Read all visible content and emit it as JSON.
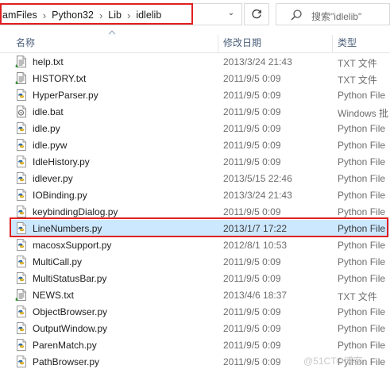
{
  "address": {
    "crumbs": [
      "amFiles",
      "Python32",
      "Lib",
      "idlelib"
    ],
    "separator": "›",
    "dropdown_glyph": "⌄",
    "refresh_glyph": "↻"
  },
  "search": {
    "placeholder": "搜索\"idlelib\""
  },
  "columns": {
    "name": "名称",
    "date": "修改日期",
    "type": "类型"
  },
  "files": [
    {
      "name": "help.txt",
      "date": "2013/3/24 21:43",
      "type": "TXT 文件",
      "icon": "text-file-icon"
    },
    {
      "name": "HISTORY.txt",
      "date": "2011/9/5 0:09",
      "type": "TXT 文件",
      "icon": "text-file-icon"
    },
    {
      "name": "HyperParser.py",
      "date": "2011/9/5 0:09",
      "type": "Python File",
      "icon": "python-file-icon"
    },
    {
      "name": "idle.bat",
      "date": "2011/9/5 0:09",
      "type": "Windows 批",
      "icon": "batch-file-icon"
    },
    {
      "name": "idle.py",
      "date": "2011/9/5 0:09",
      "type": "Python File",
      "icon": "python-file-icon"
    },
    {
      "name": "idle.pyw",
      "date": "2011/9/5 0:09",
      "type": "Python File",
      "icon": "python-file-icon"
    },
    {
      "name": "IdleHistory.py",
      "date": "2011/9/5 0:09",
      "type": "Python File",
      "icon": "python-file-icon"
    },
    {
      "name": "idlever.py",
      "date": "2013/5/15 22:46",
      "type": "Python File",
      "icon": "python-file-icon"
    },
    {
      "name": "IOBinding.py",
      "date": "2013/3/24 21:43",
      "type": "Python File",
      "icon": "python-file-icon"
    },
    {
      "name": "keybindingDialog.py",
      "date": "2011/9/5 0:09",
      "type": "Python File",
      "icon": "python-file-icon"
    },
    {
      "name": "LineNumbers.py",
      "date": "2013/1/7 17:22",
      "type": "Python File",
      "icon": "python-file-icon",
      "selected": true
    },
    {
      "name": "macosxSupport.py",
      "date": "2012/8/1 10:53",
      "type": "Python File",
      "icon": "python-file-icon"
    },
    {
      "name": "MultiCall.py",
      "date": "2011/9/5 0:09",
      "type": "Python File",
      "icon": "python-file-icon"
    },
    {
      "name": "MultiStatusBar.py",
      "date": "2011/9/5 0:09",
      "type": "Python File",
      "icon": "python-file-icon"
    },
    {
      "name": "NEWS.txt",
      "date": "2013/4/6 18:37",
      "type": "TXT 文件",
      "icon": "text-file-icon"
    },
    {
      "name": "ObjectBrowser.py",
      "date": "2011/9/5 0:09",
      "type": "Python File",
      "icon": "python-file-icon"
    },
    {
      "name": "OutputWindow.py",
      "date": "2011/9/5 0:09",
      "type": "Python File",
      "icon": "python-file-icon"
    },
    {
      "name": "ParenMatch.py",
      "date": "2011/9/5 0:09",
      "type": "Python File",
      "icon": "python-file-icon"
    },
    {
      "name": "PathBrowser.py",
      "date": "2011/9/5 0:09",
      "type": "Python File",
      "icon": "python-file-icon"
    }
  ],
  "watermark": "@51CTO博客",
  "colors": {
    "selection": "#cce8ff",
    "highlight": "#e02020",
    "header_text": "#4c607a"
  }
}
